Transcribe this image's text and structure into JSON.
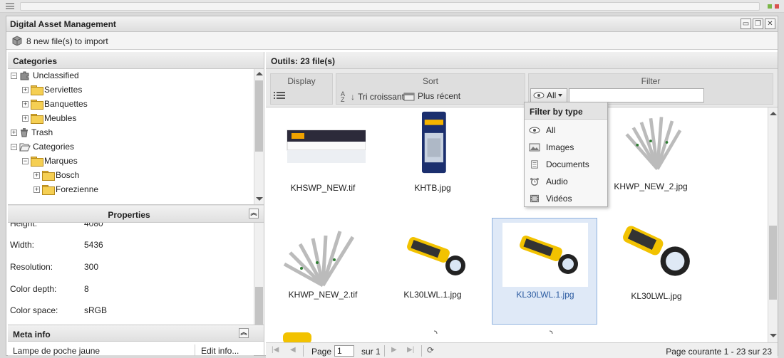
{
  "window": {
    "title": "Digital Asset Management"
  },
  "import_bar": {
    "text": "8 new file(s) to import"
  },
  "categories_panel": {
    "title": "Categories"
  },
  "tree": [
    {
      "label": "Unclassified",
      "level": 0
    },
    {
      "label": "Serviettes",
      "level": 1
    },
    {
      "label": "Banquettes",
      "level": 1
    },
    {
      "label": "Meubles",
      "level": 1
    },
    {
      "label": "Trash",
      "level": 0
    },
    {
      "label": "Categories",
      "level": 0
    },
    {
      "label": "Marques",
      "level": 1
    },
    {
      "label": "Bosch",
      "level": 2
    },
    {
      "label": "Forezienne",
      "level": 2
    }
  ],
  "properties_panel": {
    "title": "Properties"
  },
  "properties": [
    {
      "key": "Height:",
      "value": "4080"
    },
    {
      "key": "Width:",
      "value": "5436"
    },
    {
      "key": "Resolution:",
      "value": "300"
    },
    {
      "key": "Color depth:",
      "value": "8"
    },
    {
      "key": "Color space:",
      "value": "sRGB"
    }
  ],
  "meta_info": {
    "title": "Meta info",
    "first_value": "Lampe de poche jaune",
    "edit_label": "Edit info..."
  },
  "main": {
    "title": "Outils: 23 file(s)"
  },
  "toolbar": {
    "display_label": "Display",
    "sort_label": "Sort",
    "sort_alpha": "Tri croissant",
    "sort_recent": "Plus récent",
    "filter_label": "Filter",
    "filter_selected": "All"
  },
  "filter_menu": {
    "title": "Filter by type",
    "items": [
      "All",
      "Images",
      "Documents",
      "Audio",
      "Vidéos"
    ]
  },
  "files": [
    {
      "name": "KHSWP_NEW.tif"
    },
    {
      "name": "KHTB.jpg"
    },
    {
      "name": "KHWP_NEW_2.jpg"
    },
    {
      "name": "KHWP_NEW_2.tif"
    },
    {
      "name": "KL30LWL.1.jpg"
    },
    {
      "name": "KL30LWL.1.jpg"
    },
    {
      "name": "KL30LWL.jpg"
    }
  ],
  "pager": {
    "page_label": "Page",
    "page_value": "1",
    "of_label": "sur 1",
    "status": "Page courante 1 - 23 sur 23"
  }
}
